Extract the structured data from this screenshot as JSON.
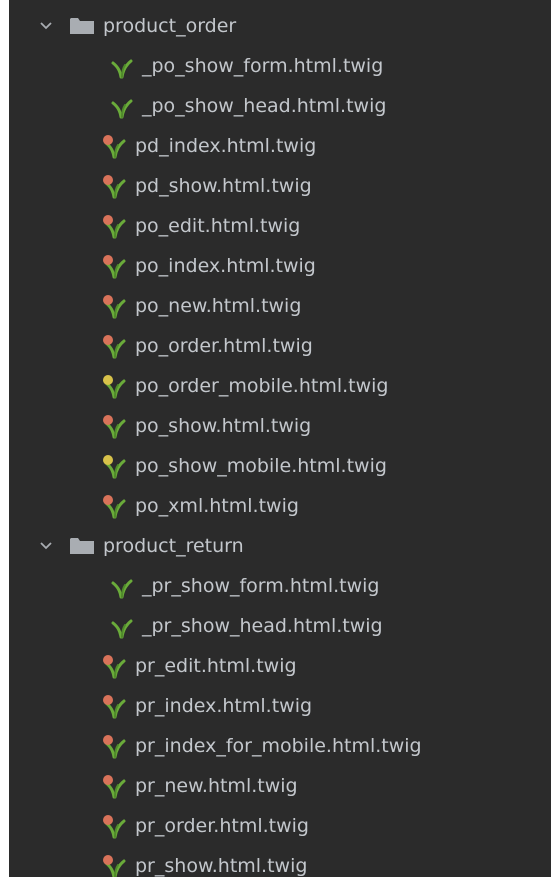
{
  "icons": {
    "folder": "folder-icon",
    "chevron": "chevron-down-icon",
    "twig_file": "twig-file-icon",
    "twig_file_modified_red": "twig-file-icon-red-dot",
    "twig_file_modified_yellow": "twig-file-icon-yellow-dot"
  },
  "colors": {
    "background": "#2b2b2b",
    "text": "#c3c7cc",
    "twig_green": "#6aab3a",
    "dot_red": "#d9735a",
    "dot_yellow": "#d8c24a",
    "folder": "#a9adb2"
  },
  "tree": [
    {
      "folder": "product_order",
      "files": [
        {
          "name": "_po_show_form.html.twig",
          "marker": "none"
        },
        {
          "name": "_po_show_head.html.twig",
          "marker": "none"
        },
        {
          "name": "pd_index.html.twig",
          "marker": "red"
        },
        {
          "name": "pd_show.html.twig",
          "marker": "red"
        },
        {
          "name": "po_edit.html.twig",
          "marker": "red"
        },
        {
          "name": "po_index.html.twig",
          "marker": "red"
        },
        {
          "name": "po_new.html.twig",
          "marker": "red"
        },
        {
          "name": "po_order.html.twig",
          "marker": "red"
        },
        {
          "name": "po_order_mobile.html.twig",
          "marker": "yellow"
        },
        {
          "name": "po_show.html.twig",
          "marker": "red"
        },
        {
          "name": "po_show_mobile.html.twig",
          "marker": "yellow"
        },
        {
          "name": "po_xml.html.twig",
          "marker": "red"
        }
      ]
    },
    {
      "folder": "product_return",
      "files": [
        {
          "name": "_pr_show_form.html.twig",
          "marker": "none"
        },
        {
          "name": "_pr_show_head.html.twig",
          "marker": "none"
        },
        {
          "name": "pr_edit.html.twig",
          "marker": "red"
        },
        {
          "name": "pr_index.html.twig",
          "marker": "red"
        },
        {
          "name": "pr_index_for_mobile.html.twig",
          "marker": "red"
        },
        {
          "name": "pr_new.html.twig",
          "marker": "red"
        },
        {
          "name": "pr_order.html.twig",
          "marker": "red"
        },
        {
          "name": "pr_show.html.twig",
          "marker": "red"
        }
      ]
    }
  ]
}
